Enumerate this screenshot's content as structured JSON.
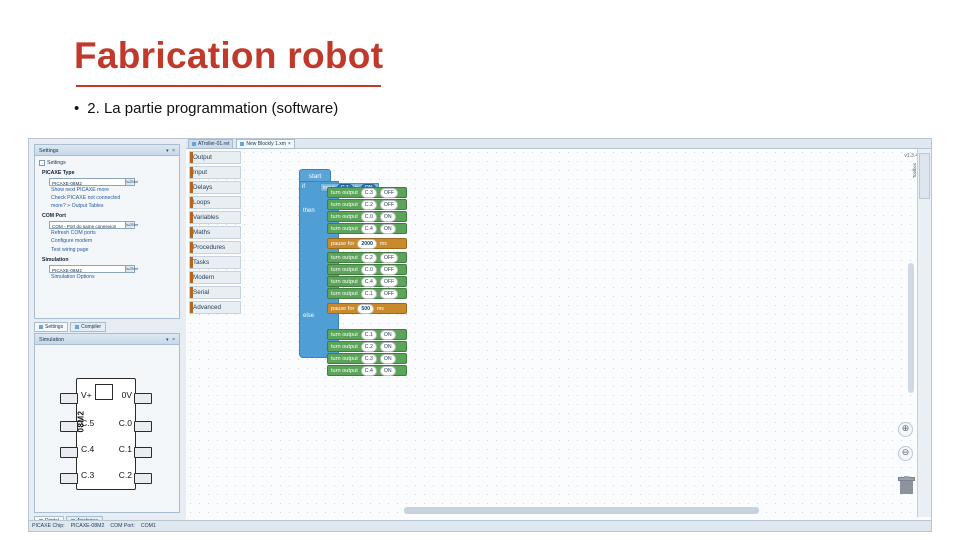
{
  "slide": {
    "title": "Fabrication robot",
    "bullet_marker": "•",
    "bullet_text": "2. La partie programmation (software)",
    "title_color": "#c0392b"
  },
  "app": {
    "version_label": "v1.3.4",
    "toolbar_tabs": [
      {
        "label": "ATroller-01.ret",
        "selected": false
      },
      {
        "label": "New Blockly 1.xm",
        "selected": true
      }
    ],
    "palette": [
      "Output",
      "Input",
      "Delays",
      "Loops",
      "Variables",
      "Maths",
      "Procedures",
      "Tasks",
      "Modern",
      "Serial",
      "Advanced"
    ],
    "right_rail_label": "Toolbox",
    "zoom_controls": [
      "⊕",
      "⊖"
    ],
    "trash_icon": "trash-icon",
    "status_left": "PICAXE Chip:",
    "status_chip": "PICAXE-08M2",
    "status_port_label": "COM Port:",
    "status_port": "COM1"
  },
  "settings_panel": {
    "title": "Settings",
    "window_controls": "▾  ×",
    "root": "Settings",
    "groups": [
      {
        "name": "PICAXE Type",
        "items": [
          "PICAXE-08M2"
        ],
        "links": [
          "Show next PICAXE more",
          "Check PICAXE not connected",
          "more? > Output Tables"
        ]
      },
      {
        "name": "COM Port",
        "items": [
          "COM - Port do same connexion"
        ],
        "links": [
          "Refresh COM ports",
          "Configure modem",
          "Test wiring page"
        ]
      },
      {
        "name": "Simulation",
        "items": [
          "PICAXE-08M2"
        ],
        "links": [
          "Simulation Options"
        ]
      }
    ],
    "tabs": [
      "Settings",
      "Compiler"
    ]
  },
  "simulation_panel": {
    "title": "Simulation",
    "window_controls": "▾  ×",
    "chip_label": "08M2",
    "left_pins": [
      "V+",
      "C.5",
      "C.4",
      "C.3"
    ],
    "right_pins": [
      "0V",
      "C.0",
      "C.1",
      "C.2"
    ],
    "tabs": [
      "Digital",
      "Analogue"
    ]
  },
  "blocks": {
    "start_label": "start",
    "if_label": "if",
    "then_label": "then",
    "else_label": "else",
    "condition": {
      "input_label": "input",
      "pin": "C.1",
      "operator": "is",
      "state": "ON"
    },
    "then_branch": [
      {
        "verb": "turn output",
        "pin": "C.3",
        "state": "OFF"
      },
      {
        "verb": "turn output",
        "pin": "C.2",
        "state": "OFF"
      },
      {
        "verb": "turn output",
        "pin": "C.0",
        "state": "ON"
      },
      {
        "verb": "turn output",
        "pin": "C.4",
        "state": "ON"
      },
      {
        "verb": "pause for",
        "value": "2000",
        "unit": "ms"
      },
      {
        "verb": "turn output",
        "pin": "C.2",
        "state": "OFF"
      },
      {
        "verb": "turn output",
        "pin": "C.0",
        "state": "OFF"
      },
      {
        "verb": "turn output",
        "pin": "C.4",
        "state": "OFF"
      },
      {
        "verb": "turn output",
        "pin": "C.1",
        "state": "OFF"
      },
      {
        "verb": "pause for",
        "value": "500",
        "unit": "ms"
      }
    ],
    "else_branch": [
      {
        "verb": "turn output",
        "pin": "C.1",
        "state": "ON"
      },
      {
        "verb": "turn output",
        "pin": "C.2",
        "state": "ON"
      },
      {
        "verb": "turn output",
        "pin": "C.3",
        "state": "ON"
      },
      {
        "verb": "turn output",
        "pin": "C.4",
        "state": "ON"
      }
    ]
  }
}
